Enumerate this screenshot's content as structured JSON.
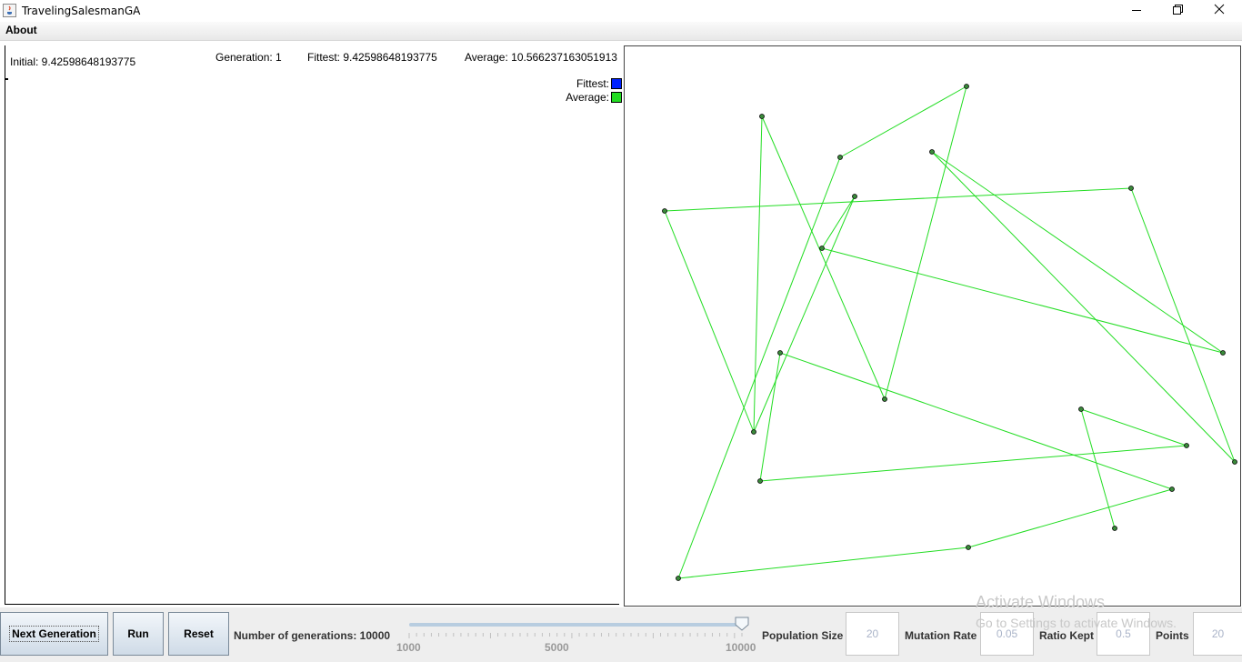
{
  "window": {
    "title": "TravelingSalesmanGA",
    "minimize_glyph": "—",
    "maximize_glyph": "❐",
    "close_glyph": "✕"
  },
  "menu": {
    "about": "About"
  },
  "stats": {
    "initial": "Initial: 9.42598648193775",
    "generation": "Generation: 1",
    "fittest": "Fittest: 9.42598648193775",
    "average": "Average: 10.566237163051913"
  },
  "legend": {
    "fittest_label": "Fittest:",
    "average_label": "Average:",
    "fittest_color": "#0022ff",
    "average_color": "#22dd22"
  },
  "tour": {
    "line_color": "#22dd22",
    "point_order_note": "",
    "points": [
      [
        838,
        128
      ],
      [
        973,
        439
      ],
      [
        1063,
        95
      ],
      [
        924,
        173
      ],
      [
        746,
        636
      ],
      [
        1065,
        602
      ],
      [
        1289,
        538
      ],
      [
        858,
        388
      ],
      [
        836,
        529
      ],
      [
        1305,
        490
      ],
      [
        1189,
        450
      ],
      [
        1226,
        581
      ],
      [
        1025,
        167
      ],
      [
        1345,
        388
      ],
      [
        904,
        273
      ],
      [
        940,
        216
      ],
      [
        829,
        475
      ],
      [
        731,
        232
      ],
      [
        1244,
        207
      ],
      [
        1358,
        508
      ]
    ]
  },
  "controls": {
    "next_generation": "Next Generation",
    "run": "Run",
    "reset": "Reset",
    "num_generations_label": "Number of generations: 10000",
    "slider": {
      "min": 1000,
      "max": 10000,
      "value": 10000,
      "ticks": [
        "1000",
        "5000",
        "10000"
      ]
    },
    "population_size_label": "Population Size",
    "population_size_value": "20",
    "mutation_rate_label": "Mutation Rate",
    "mutation_rate_value": "0.05",
    "ratio_kept_label": "Ratio Kept",
    "ratio_kept_value": "0.5",
    "points_label": "Points",
    "points_value": "20"
  },
  "watermark": {
    "line1": "Activate Windows",
    "line2": "Go to Settings to activate Windows."
  }
}
